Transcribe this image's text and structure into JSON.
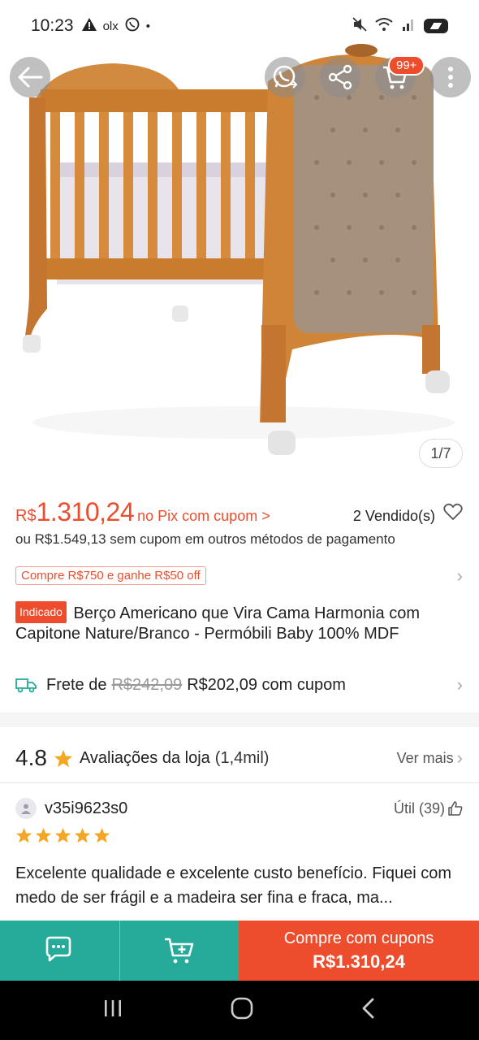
{
  "status_bar": {
    "time": "10:23",
    "left_icons": [
      "warning-icon",
      "olx-icon",
      "whatsapp-icon",
      "dot-icon"
    ],
    "olx_text": "olx",
    "right_icons": [
      "mute-icon",
      "wifi-icon",
      "signal-icon",
      "battery-icon"
    ]
  },
  "top_actions": {
    "cart_badge": "99+"
  },
  "gallery": {
    "counter": "1/7"
  },
  "price": {
    "currency": "R$",
    "amount": "1.310,24",
    "pix_label": "no Pix com cupom >",
    "sold": "2 Vendido(s)",
    "alt_price": "ou R$1.549,13 sem cupom em outros métodos de pagamento",
    "promo": "Compre R$750 e ganhe R$50 off"
  },
  "product": {
    "badge": "Indicado",
    "title": "Berço Americano que Vira Cama Harmonia com Capitone Nature/Branco - Permóbili Baby 100% MDF"
  },
  "shipping": {
    "label": "Frete de",
    "old_price": "R$242,09",
    "new_price": "R$202,09 com cupom"
  },
  "store_rating": {
    "score": "4.8",
    "label": "Avaliações da loja",
    "count": "(1,4mil)",
    "see_more": "Ver mais"
  },
  "review": {
    "username": "v35i9623s0",
    "helpful": "Útil (39)",
    "stars": 5,
    "text": "Excelente qualidade e excelente custo benefício. Fiquei com medo de ser frágil e a madeira ser fina e fraca, ma..."
  },
  "bottom_bar": {
    "buy_label": "Compre com cupons",
    "buy_price": "R$1.310,24"
  },
  "colors": {
    "accent": "#ee4d2d",
    "teal": "#26aa99",
    "star": "#f5a623"
  }
}
